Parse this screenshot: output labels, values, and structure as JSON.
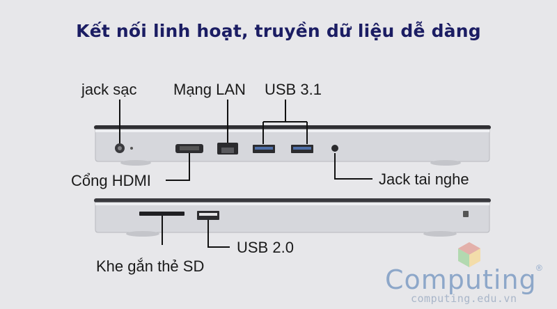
{
  "title": "Kết nối linh hoạt, truyền dữ liệu dễ dàng",
  "labels": {
    "jack_sac": "jack sạc",
    "mang_lan": "Mạng LAN",
    "usb31": "USB 3.1",
    "cong_hdmi": "Cổng HDMI",
    "jack_tai_nghe": "Jack tai nghe",
    "usb20": "USB 2.0",
    "khe_sd": "Khe gắn thẻ SD"
  },
  "watermark": {
    "brand": "Computing",
    "registered": "®",
    "url": "computing.edu.vn"
  },
  "colors": {
    "title": "#1b1d63",
    "laptop_body": "#d5d6db",
    "callout_line": "#111111",
    "watermark": "#8da7c9"
  }
}
